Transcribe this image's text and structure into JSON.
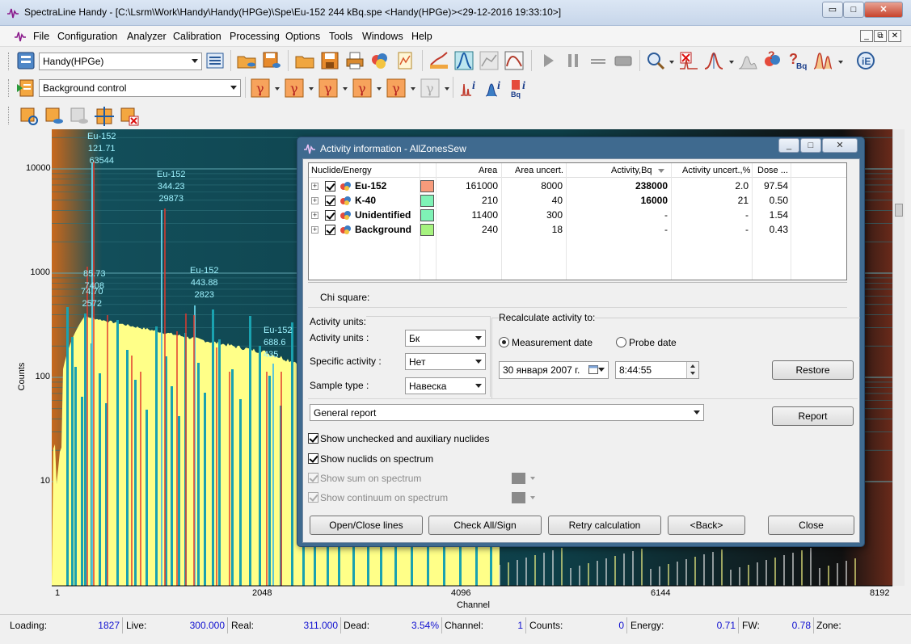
{
  "window": {
    "title": "SpectraLine Handy - [C:\\Lsrm\\Work\\Handy\\Handy(HPGe)\\Spe\\Eu-152  244 kBq.spe  <Handy(HPGe)><29-12-2016 19:33:10>]",
    "min": "▭",
    "max": "□",
    "close": "✕"
  },
  "menu": {
    "items": [
      "File",
      "Configuration",
      "Analyzer",
      "Calibration",
      "Processing",
      "Options",
      "Tools",
      "Windows",
      "Help"
    ],
    "mdi_min": "_",
    "mdi_restore": "⧉",
    "mdi_close": "✕"
  },
  "toolbar": {
    "device_combo": "Handy(HPGe)",
    "mode_combo": "Background control"
  },
  "spectrum": {
    "y_axis_label": "Counts",
    "x_axis_label": "Channel",
    "y_ticks": [
      "10000",
      "1000",
      "100",
      "10"
    ],
    "x_ticks": [
      "1",
      "2048",
      "4096",
      "6144",
      "8192"
    ],
    "peaks": [
      {
        "text": "Eu-152\n121.71\n63544"
      },
      {
        "text": "Eu-152\n344.23\n29873"
      },
      {
        "text": "Eu-152\n443.88\n2823"
      },
      {
        "text": "85.73\n7408"
      },
      {
        "text": "74.70\n2572"
      },
      {
        "text": "Eu-152\n688.6\n435"
      }
    ],
    "colors": {
      "background": "#0d4a55",
      "fill": "#ffff88",
      "lines": "#1aa2b0",
      "peaks": "#e23b2e"
    }
  },
  "status": {
    "loading_label": "Loading:",
    "loading_value": "1827",
    "live_label": "Live:",
    "live_value": "300.000",
    "real_label": "Real:",
    "real_value": "311.000",
    "dead_label": "Dead:",
    "dead_value": "3.54%",
    "channel_label": "Channel:",
    "channel_value": "1",
    "counts_label": "Counts:",
    "counts_value": "0",
    "energy_label": "Energy:",
    "energy_value": "0.71",
    "fw_label": "FW:",
    "fw_value": "0.78",
    "zone_label": "Zone:"
  },
  "dialog": {
    "title": "Activity information - AllZonesSew",
    "columns": [
      "Nuclide/Energy",
      "Area",
      "Area uncert.",
      "Activity,Bq",
      "Activity uncert.,%",
      "Dose ..."
    ],
    "rows": [
      {
        "name": "Eu-152",
        "color": "#f79b7b",
        "area": "161000",
        "area_unc": "8000",
        "activity": "238000",
        "act_unc": "2.0",
        "dose": "97.54"
      },
      {
        "name": "K-40",
        "color": "#7ff2b6",
        "area": "210",
        "area_unc": "40",
        "activity": "16000",
        "act_unc": "21",
        "dose": "0.50"
      },
      {
        "name": "Unidentified",
        "color": "#7ff2b6",
        "area": "11400",
        "area_unc": "300",
        "activity": "-",
        "act_unc": "-",
        "dose": "1.54"
      },
      {
        "name": "Background",
        "color": "#a6f37f",
        "area": "240",
        "area_unc": "18",
        "activity": "-",
        "act_unc": "-",
        "dose": "0.43"
      }
    ],
    "chi_square_label": "Chi square:",
    "activity_units_group": "Activity units:",
    "activity_units_label": "Activity units :",
    "activity_units_value": "Бк",
    "specific_activity_label": "Specific activity :",
    "specific_activity_value": "Нет",
    "sample_type_label": "Sample type :",
    "sample_type_value": "Навеска",
    "recalc_group": "Recalculate activity to:",
    "radio_measurement": "Measurement date",
    "radio_probe": "Probe date",
    "date_value": "30  января   2007 г.",
    "time_value": "8:44:55",
    "restore_button": "Restore",
    "report_combo": "General report",
    "report_button": "Report",
    "cb_show_unchecked": "Show unchecked and auxiliary nuclides",
    "cb_show_nuclids": "Show nuclids on spectrum",
    "cb_show_sum": "Show sum on spectrum",
    "cb_show_continuum": "Show continuum on spectrum",
    "btn_open_close": "Open/Close lines",
    "btn_check_all": "Check All/Sign",
    "btn_retry": "Retry calculation",
    "btn_back": "<Back>",
    "btn_close": "Close"
  }
}
